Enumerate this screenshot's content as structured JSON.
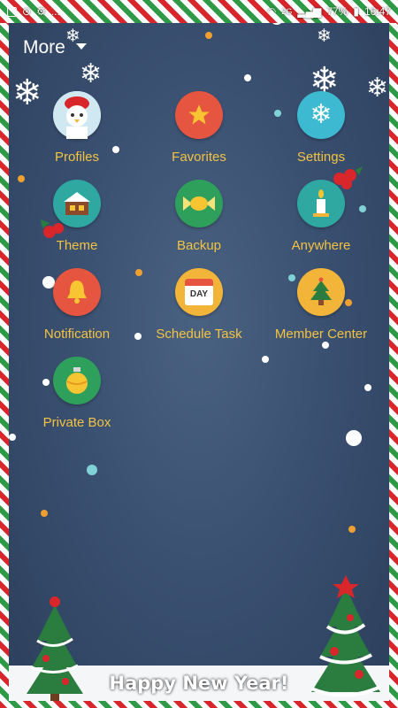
{
  "status_bar": {
    "signal_label": "2G",
    "battery_percent": "77%",
    "time": "16:47",
    "overflow": "..."
  },
  "header": {
    "title": "More"
  },
  "menu": {
    "items": [
      {
        "label": "Profiles",
        "icon": "chef-avatar-icon",
        "color": "#e9f3f8"
      },
      {
        "label": "Favorites",
        "icon": "star-icon",
        "color": "#e5553f"
      },
      {
        "label": "Settings",
        "icon": "snowflake-icon",
        "color": "#3eb9d2"
      },
      {
        "label": "Theme",
        "icon": "house-icon",
        "color": "#2ea8a0"
      },
      {
        "label": "Backup",
        "icon": "candy-icon",
        "color": "#2ea05c"
      },
      {
        "label": "Anywhere",
        "icon": "candle-icon",
        "color": "#2ea8a0"
      },
      {
        "label": "Notification",
        "icon": "bell-icon",
        "color": "#e5553f"
      },
      {
        "label": "Schedule Task",
        "icon": "calendar-icon",
        "color": "#f2b53a"
      },
      {
        "label": "Member Center",
        "icon": "tree-icon",
        "color": "#f2b53a"
      },
      {
        "label": "Private Box",
        "icon": "ornament-icon",
        "color": "#2ea05c"
      }
    ],
    "calendar_text": "DAY"
  },
  "footer": {
    "greeting": "Happy New Year!"
  },
  "theme": {
    "accent_label": "#f3c342",
    "stripe_red": "#d8262b",
    "stripe_green": "#2e9a45"
  }
}
